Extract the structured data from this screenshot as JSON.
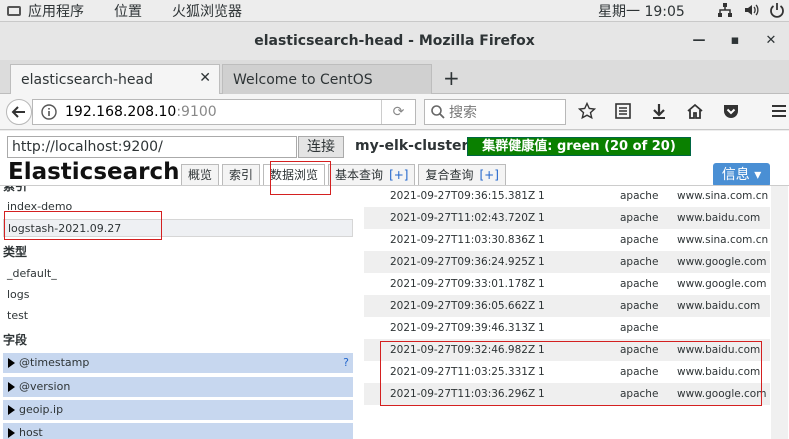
{
  "desktop": {
    "apps_menu": "应用程序",
    "places_menu": "位置",
    "browser_menu": "火狐浏览器",
    "clock": "星期一 19:05"
  },
  "window": {
    "title": "elasticsearch-head - Mozilla Firefox"
  },
  "tabs": [
    {
      "label": "elasticsearch-head"
    },
    {
      "label": "Welcome to CentOS"
    }
  ],
  "nav": {
    "url_host": "192.168.208.10",
    "url_port": ":9100",
    "search_placeholder": "搜索"
  },
  "es": {
    "connect_url": "http://localhost:9200/",
    "connect_button": "连接",
    "cluster_name": "my-elk-cluster",
    "health": "集群健康值: green (20 of 20)",
    "brand": "Elasticsearch",
    "tabs": [
      "概览",
      "索引",
      "数据浏览",
      "基本查询",
      "复合查询"
    ],
    "tab_plus": "[+]",
    "info_button": "信息"
  },
  "sidebar": {
    "cut_header": "索引",
    "indices": [
      "index-demo",
      "logstash-2021.09.27"
    ],
    "types_header": "类型",
    "types": [
      "_default_",
      "logs",
      "test"
    ],
    "fields_header": "字段",
    "fields": [
      "@timestamp",
      "@version",
      "geoip.ip",
      "host"
    ],
    "help_mark": "?"
  },
  "results": {
    "rows": [
      {
        "ts": "2021-09-27T09:36:15.381Z",
        "n": "1",
        "type": "apache",
        "host": "www.sina.com.cn"
      },
      {
        "ts": "2021-09-27T11:02:43.720Z",
        "n": "1",
        "type": "apache",
        "host": "www.baidu.com"
      },
      {
        "ts": "2021-09-27T11:03:30.836Z",
        "n": "1",
        "type": "apache",
        "host": "www.sina.com.cn"
      },
      {
        "ts": "2021-09-27T09:36:24.925Z",
        "n": "1",
        "type": "apache",
        "host": "www.google.com"
      },
      {
        "ts": "2021-09-27T09:33:01.178Z",
        "n": "1",
        "type": "apache",
        "host": "www.google.com"
      },
      {
        "ts": "2021-09-27T09:36:05.662Z",
        "n": "1",
        "type": "apache",
        "host": "www.baidu.com"
      },
      {
        "ts": "2021-09-27T09:39:46.313Z",
        "n": "1",
        "type": "apache",
        "host": ""
      },
      {
        "ts": "2021-09-27T09:32:46.982Z",
        "n": "1",
        "type": "apache",
        "host": "www.baidu.com"
      },
      {
        "ts": "2021-09-27T11:03:25.331Z",
        "n": "1",
        "type": "apache",
        "host": "www.baidu.com"
      },
      {
        "ts": "2021-09-27T11:03:36.296Z",
        "n": "1",
        "type": "apache",
        "host": "www.google.com"
      }
    ]
  },
  "colors": {
    "health_green": "#0a8000",
    "annotation_red": "#d42020",
    "field_row_blue": "#c7d7ef",
    "info_button_blue": "#4a8fd4"
  }
}
